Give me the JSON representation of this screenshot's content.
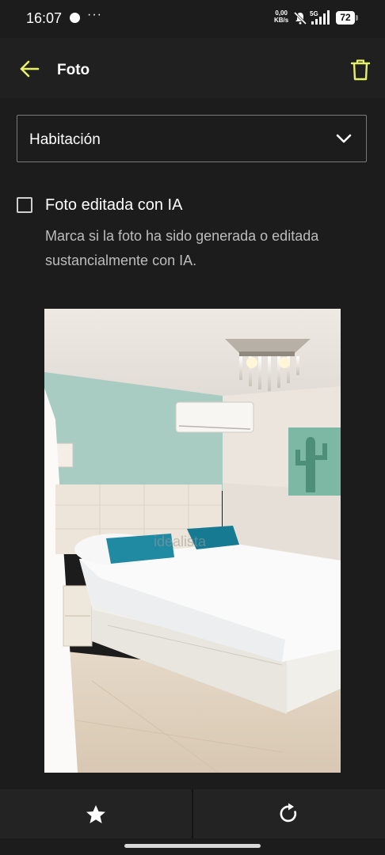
{
  "status_bar": {
    "time": "16:07",
    "more": "···",
    "net_speed_value": "0,00",
    "net_speed_unit": "KB/s",
    "network_type": "5G",
    "battery": "72"
  },
  "app_bar": {
    "title": "Foto",
    "back_icon": "arrow-left-icon",
    "delete_icon": "trash-icon",
    "accent_color": "#e6f06a"
  },
  "form": {
    "room_type": "Habitación",
    "ai_checkbox_label": "Foto editada con IA",
    "ai_checkbox_checked": false,
    "ai_checkbox_help": "Marca si la foto ha sido generada o editada sustancialmente con IA."
  },
  "photo": {
    "watermark": "idealista",
    "subject": "bedroom"
  },
  "bottom_bar": {
    "left_icon": "star-icon",
    "right_icon": "rotate-icon"
  }
}
